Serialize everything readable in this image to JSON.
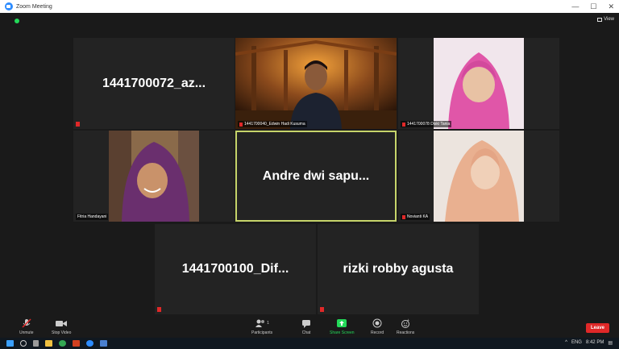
{
  "window": {
    "title": "Zoom Meeting",
    "minimize": "—",
    "maximize": "☐",
    "close": "✕"
  },
  "view": {
    "label": "View"
  },
  "participants": [
    {
      "id": "p1",
      "display": "1441700072_az...",
      "label": "",
      "video": false
    },
    {
      "id": "p2",
      "display": "",
      "label": "1441700040_Edwin Hadi Kusuma",
      "video": true
    },
    {
      "id": "p3",
      "display": "",
      "label": "1441700078 Diski Tania",
      "video": true
    },
    {
      "id": "p4",
      "display": "",
      "label": "Fitria Handayani",
      "video": true
    },
    {
      "id": "p5",
      "display": "Andre dwi sapu...",
      "label": "",
      "video": false,
      "active": true
    },
    {
      "id": "p6",
      "display": "",
      "label": "Novianti KA",
      "video": true
    },
    {
      "id": "p7",
      "display": "1441700100_Dif...",
      "label": "",
      "video": false
    },
    {
      "id": "p8",
      "display": "rizki robby agusta",
      "label": "",
      "video": false
    }
  ],
  "toolbar": {
    "unmute": "Unmute",
    "stop_video": "Stop Video",
    "participants": "Participants",
    "participants_count": "1",
    "chat": "Chat",
    "share_screen": "Share Screen",
    "record": "Record",
    "reactions": "Reactions",
    "leave": "Leave"
  },
  "taskbar": {
    "tray_lang": "ENG",
    "time": "8:42 PM"
  },
  "colors": {
    "accent": "#2d8cff",
    "active_border": "#c6d46a",
    "danger": "#e02828",
    "share": "#23d959"
  }
}
